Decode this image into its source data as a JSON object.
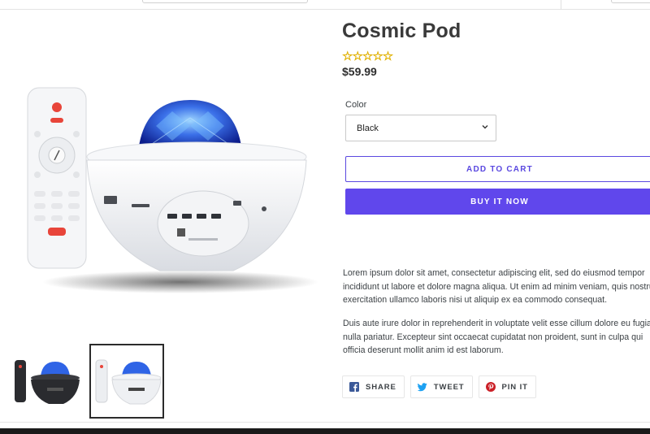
{
  "product": {
    "title": "Cosmic Pod",
    "rating_stars": "☆☆☆☆☆",
    "rating_value": 0,
    "price": "$59.99"
  },
  "variant": {
    "color_label": "Color",
    "selected": "Black"
  },
  "actions": {
    "add_to_cart": "ADD TO CART",
    "buy_now": "BUY IT NOW"
  },
  "description": {
    "p1": "Lorem ipsum dolor sit amet, consectetur adipiscing elit, sed do eiusmod tempor incididunt ut labore et dolore magna aliqua. Ut enim ad minim veniam, quis nostrud exercitation ullamco laboris nisi ut aliquip ex ea commodo consequat.",
    "p2": "Duis aute irure dolor in reprehenderit in voluptate velit esse cillum dolore eu fugiat nulla pariatur. Excepteur sint occaecat cupidatat non proident, sunt in culpa qui officia deserunt mollit anim id est laborum."
  },
  "share": {
    "facebook": "SHARE",
    "twitter": "TWEET",
    "pinterest": "PIN IT"
  },
  "colors": {
    "accent": "#6047ec",
    "stars": "#f5c518"
  },
  "icons": [
    "facebook-icon",
    "twitter-icon",
    "pinterest-icon",
    "chevron-down-icon"
  ]
}
